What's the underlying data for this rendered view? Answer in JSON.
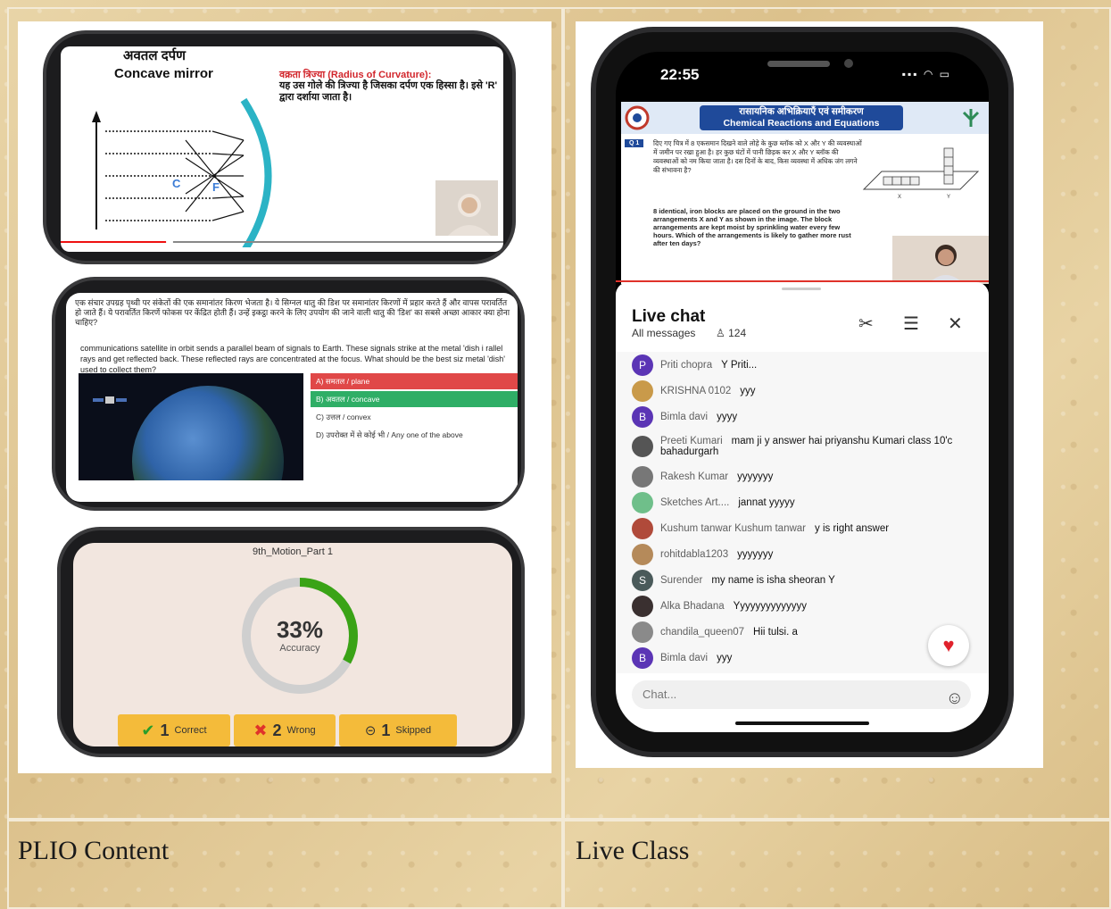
{
  "captions": {
    "left": "PLIO Content",
    "right": "Live Class"
  },
  "video": {
    "title_hi": "अवतल दर्पण",
    "title_en": "Concave mirror",
    "roc_title": "वक्रता त्रिज्या (Radius of Curvature):",
    "roc_body": "यह उस गोले की त्रिज्या है जिसका दर्पण एक हिस्सा है। इसे 'R' द्वारा दर्शाया जाता है।",
    "label_c": "C",
    "label_f": "F"
  },
  "quiz": {
    "question_hi": "एक संचार उपग्रह पृथ्वी पर संकेतों की एक समानांतर किरण भेजता है। ये सिग्नल धातु की डिश पर समानांतर किरणों में प्रहार करते हैं और वापस परावर्तित हो जाते हैं। ये परावर्तित किरणें फोकस पर केंद्रित होती हैं। उन्हें इकट्ठा करने के लिए उपयोग की जाने वाली धातु की 'डिश' का सबसे अच्छा आकार क्या होना चाहिए?",
    "question_en": "communications satellite in orbit sends a parallel beam of signals to Earth. These signals strike at the metal 'dish i rallel rays and get reflected back. These reflected rays are concentrated at the focus. What should be the best siz metal 'dish' used to collect them?",
    "options": [
      {
        "text": "A) समतल / plane",
        "state": "wrong"
      },
      {
        "text": "B) अवतल / concave",
        "state": "correct"
      },
      {
        "text": "C) उत्तल / convex",
        "state": "none"
      },
      {
        "text": "D) उपरोक्त में से कोई भी / Any one of the above",
        "state": "none"
      }
    ]
  },
  "results": {
    "lesson": "9th_Motion_Part 1",
    "accuracy_pct": "33%",
    "accuracy_fraction": 0.33,
    "accuracy_label": "Accuracy",
    "correct_count": "1",
    "correct_label": "Correct",
    "wrong_count": "2",
    "wrong_label": "Wrong",
    "skipped_count": "1",
    "skipped_label": "Skipped",
    "colors": {
      "ring_fill": "#3aa316",
      "ring_track": "#cfcfcf",
      "stat_bg": "#f4bb3a"
    }
  },
  "live": {
    "time": "22:55",
    "banner_hi": "रासायनिक अभिक्रियाएँ एवं समीकरण",
    "banner_en": "Chemical Reactions and Equations",
    "qnum": "Q 1",
    "question_hi": "दिए गए चित्र में 8 एकसमान दिखने वाले लोहे के कुछ ब्लॉक को X और Y की व्यवस्थाओं में जमीन पर रखा हुआ है। हर कुछ घंटों में पानी छिड़क कर X और Y ब्लॉक की व्यवस्थाओं को नम किया जाता है। दस दिनों के बाद, किस व्यवस्था में अधिक जंग लगने की संभावना है?",
    "question_en": "8 identical, iron blocks are placed on the ground in the two arrangements X and Y as shown in the image. The block arrangements are kept moist by sprinkling water every few hours. Which of the arrangements is likely to gather more rust after ten days?",
    "label_x": "X",
    "label_y": "Y",
    "chat_title": "Live chat",
    "chat_filter": "All messages",
    "viewer_count": "124",
    "input_placeholder": "Chat...",
    "messages": [
      {
        "initial": "P",
        "color": "#5b35b5",
        "name": "Priti chopra",
        "text": "Y Priti..."
      },
      {
        "initial": "",
        "color": "#c99a4a",
        "name": "KRISHNA 0102",
        "text": "yyy"
      },
      {
        "initial": "B",
        "color": "#5b35b5",
        "name": "Bimla davi",
        "text": "yyyy"
      },
      {
        "initial": "",
        "color": "#555555",
        "name": "Preeti Kumari",
        "text": "mam ji y answer hai priyanshu Kumari class 10'c bahadurgarh"
      },
      {
        "initial": "",
        "color": "#777777",
        "name": "Rakesh Kumar",
        "text": "yyyyyyy"
      },
      {
        "initial": "",
        "color": "#6fbf8a",
        "name": "Sketches Art....",
        "text": "jannat yyyyy"
      },
      {
        "initial": "",
        "color": "#b04a3a",
        "name": "Kushum tanwar Kushum tanwar",
        "text": "y is right answer"
      },
      {
        "initial": "",
        "color": "#b58a5a",
        "name": "rohitdabla1203",
        "text": "yyyyyyy"
      },
      {
        "initial": "S",
        "color": "#4a5a5a",
        "name": "Surender",
        "text": "my name is isha sheoran Y"
      },
      {
        "initial": "",
        "color": "#3a3030",
        "name": "Alka Bhadana",
        "text": "Yyyyyyyyyyyyyy"
      },
      {
        "initial": "",
        "color": "#8a8a8a",
        "name": "chandila_queen07",
        "text": "Hii tulsi. a"
      },
      {
        "initial": "B",
        "color": "#5b35b5",
        "name": "Bimla davi",
        "text": "yyy"
      }
    ]
  }
}
